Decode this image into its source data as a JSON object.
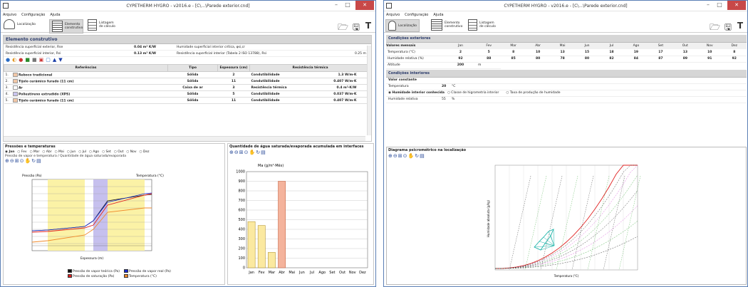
{
  "w1": {
    "title": "CYPETHERM HYGRO - v2016.e - [C\\...\\Parede exterior.cnd]",
    "menu": [
      "Arquivo",
      "Configuração",
      "Ajuda"
    ],
    "toolbar": {
      "loc": "Localização",
      "elem": "Elemento construtivo",
      "list": "Listagem de cálculo"
    },
    "section_title": "Elemento construtivo",
    "rse_label": "Resistência superficial exterior, Rse",
    "rse_value": "0.04 m² K/W",
    "rse_note": "Humidade superficial interior crítica, φsi,cr",
    "rsi_label": "Resistência superficial interior, Rsi",
    "rsi_value": "0.13 m² K/W",
    "rsi_note": "Resistência superficial interior (Tabela 2 ISO 13788), Rsi",
    "rsi_right": "0.25 m",
    "table_headers": [
      "Referências",
      "Tipo",
      "Espessura (cm)",
      "Resistência térmica"
    ],
    "layers": [
      {
        "n": "1.",
        "color": "#f2c7a6",
        "name": "Reboco tradicional",
        "type": "Sólida",
        "thk": "2",
        "prop": "Condutibilidade",
        "val": "1.3 W/m·K"
      },
      {
        "n": "2.",
        "color": "#f2c7a6",
        "name": "Tijolo cerâmico furado (11 cm)",
        "type": "Sólida",
        "thk": "11",
        "prop": "Condutibilidade",
        "val": "0.407 W/m·K"
      },
      {
        "n": "3.",
        "color": "#ffffff",
        "name": "Ar",
        "type": "Caixa de ar",
        "thk": "3",
        "prop": "Resistência térmica",
        "val": "0.4 m²·K/W"
      },
      {
        "n": "4.",
        "color": "#c9c4ee",
        "name": "Poliestireno extrudido (XPS)",
        "type": "Sólida",
        "thk": "5",
        "prop": "Condutibilidade",
        "val": "0.037 W/m·K"
      },
      {
        "n": "5.",
        "color": "#f2c7a6",
        "name": "Tijolo cerâmico furado (11 cm)",
        "type": "Sólida",
        "thk": "11",
        "prop": "Condutibilidade",
        "val": "0.407 W/m·K"
      }
    ],
    "left_panel": {
      "title": "Pressões e temperaturas",
      "months": [
        "Jan",
        "Fev",
        "Mar",
        "Abr",
        "Mai",
        "Jun",
        "Jul",
        "Ago",
        "Set",
        "Out",
        "Nov",
        "Dez"
      ],
      "subtab": "Pressão de vapor e temperatura / Quantidade de água saturada/evaporada",
      "y_left_label": "Pressão (Pa)",
      "y_right_label": "Temperatura (°C)",
      "x_label": "Espessura (m)",
      "legend": [
        {
          "color": "#111111",
          "label": "Pressão de vapor teórica (Pa)"
        },
        {
          "color": "#1a2bd0",
          "label": "Pressão de vapor real (Pa)"
        },
        {
          "color": "#e02020",
          "label": "Pressão de saturação (Pa)"
        },
        {
          "color": "#f08a2c",
          "label": "Temperatura (°C)"
        }
      ]
    },
    "right_panel": {
      "title": "Quantidade de água saturada/evaporada acumulada em interfaces",
      "unit": "Ma (g/m²·Mês)"
    }
  },
  "w2": {
    "title": "CYPETHERM HYGRO - v2016.e - [C\\...\\Parede exterior.cnd]",
    "menu": [
      "Arquivo",
      "Configuração",
      "Ajuda"
    ],
    "toolbar": {
      "loc": "Localização",
      "elem": "Elemento construtivo",
      "list": "Listagem de cálculo"
    },
    "ext_title": "Condições exteriores",
    "monthly_label": "Valores mensais",
    "months": [
      "Jan",
      "Fev",
      "Mar",
      "Abr",
      "Mai",
      "Jun",
      "Jul",
      "Ago",
      "Set",
      "Out",
      "Nov",
      "Dez"
    ],
    "temp_label": "Temperatura (°C)",
    "temps": [
      "2",
      "5",
      "8",
      "10",
      "13",
      "15",
      "18",
      "19",
      "17",
      "13",
      "10",
      "8"
    ],
    "hum_label": "Humidade relativa (%)",
    "hums": [
      "92",
      "88",
      "85",
      "80",
      "78",
      "80",
      "82",
      "84",
      "87",
      "89",
      "91",
      "92"
    ],
    "alt_label": "Altitude",
    "alt_value": "200",
    "alt_unit": "m",
    "int_title": "Condições interiores",
    "const_label": "Valor constante",
    "int_temp_label": "Temperatura",
    "int_temp_value": "20",
    "int_temp_unit": "°C",
    "radio1": "Humidade interior conhecida",
    "radio2": "Classe de higrometria interior",
    "radio3": "Taxa de produção de humidade",
    "int_hum_label": "Humidade relativa",
    "int_hum_value": "55",
    "int_hum_unit": "%",
    "psy_title": "Diagrama psicrométrico na localização",
    "psy_xlabel": "Temperatura (°C)",
    "psy_ylabel": "Humidade absoluta (g/kg)"
  },
  "chart_data": [
    {
      "type": "bar",
      "title": "Quantidade de água saturada/evaporada acumulada em interfaces",
      "ylabel": "Ma (g/m²·Mês)",
      "categories": [
        "Jan",
        "Fev",
        "Mar",
        "Abr",
        "Mai",
        "Jun",
        "Jul",
        "Ago",
        "Set",
        "Out",
        "Nov",
        "Dez"
      ],
      "y_ticks": [
        "0",
        "100",
        "200",
        "300",
        "400",
        "500",
        "600",
        "700",
        "800",
        "900",
        "1000"
      ],
      "ylim": [
        0,
        1000
      ],
      "series": [
        {
          "values": [
            480,
            440,
            160,
            900,
            0,
            0,
            0,
            0,
            0,
            0,
            0,
            0
          ]
        }
      ]
    }
  ]
}
